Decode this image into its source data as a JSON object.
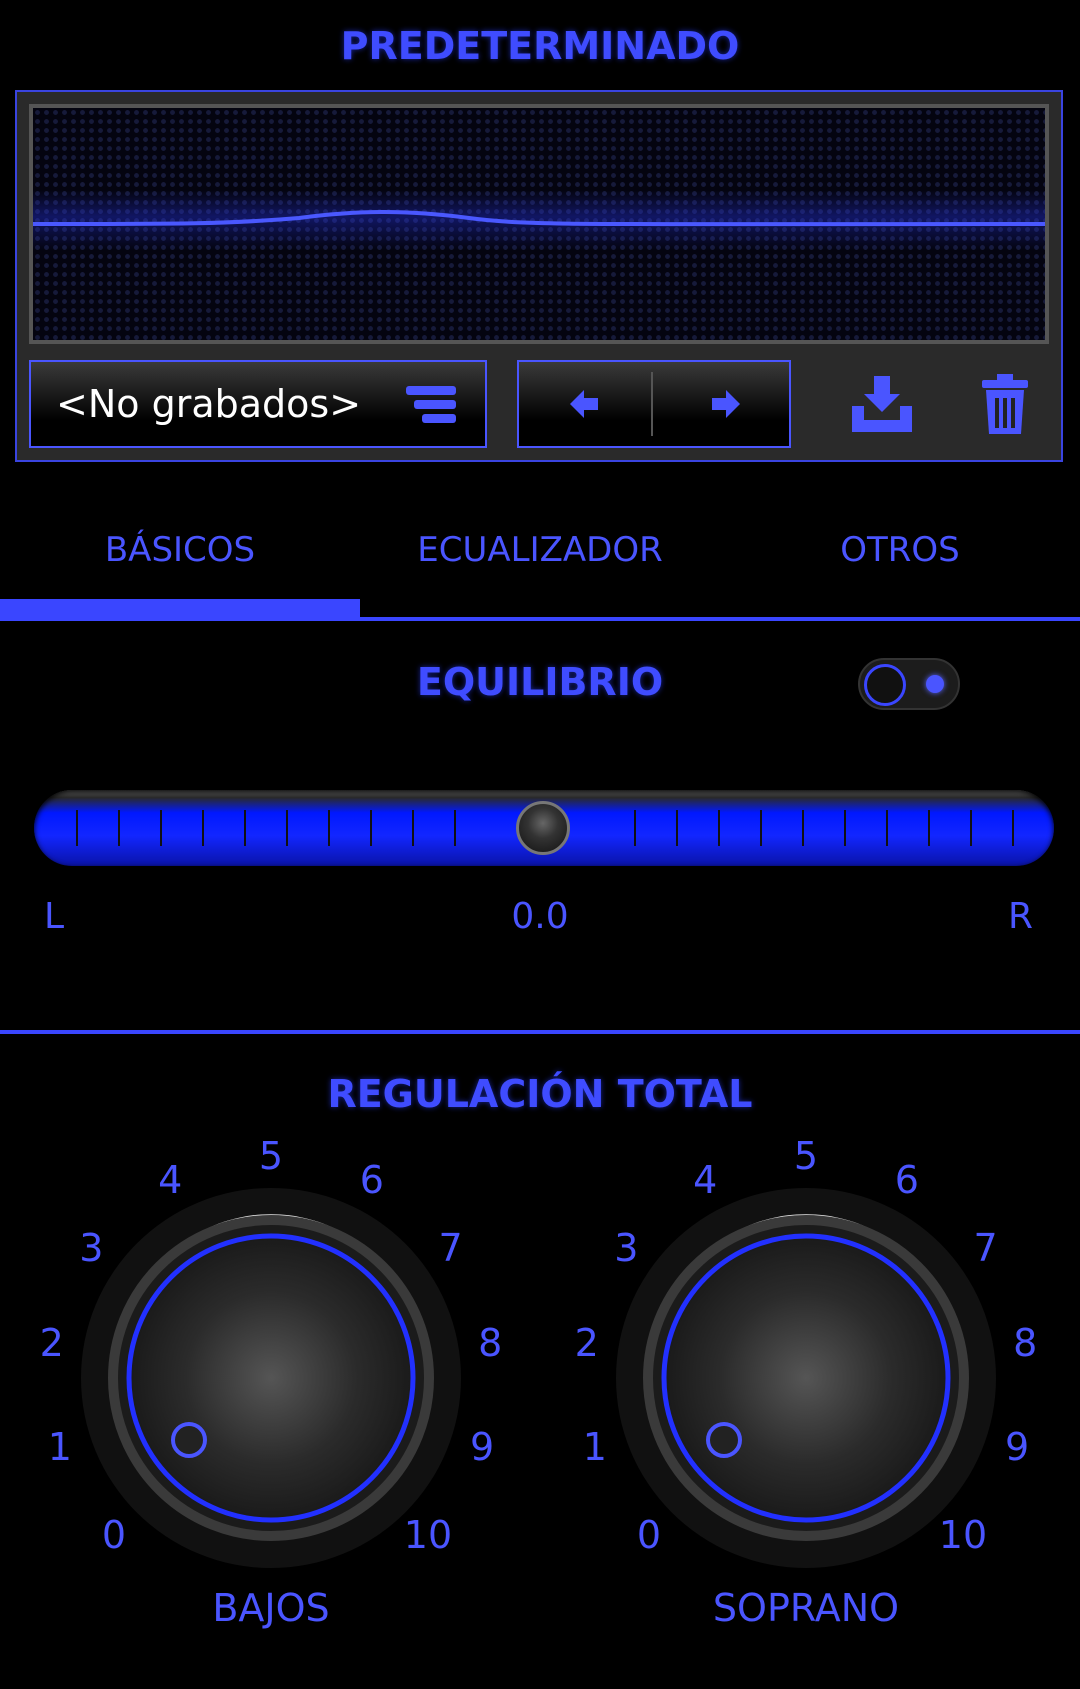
{
  "preset": {
    "title": "PREDETERMINADO",
    "name": "<No grabados>"
  },
  "icons": {
    "list": "list-lines-icon",
    "prev": "arrow-left-icon",
    "next": "arrow-right-icon",
    "save": "download-tray-icon",
    "delete": "trash-icon"
  },
  "tabs": [
    {
      "label": "BÁSICOS",
      "active": true
    },
    {
      "label": "ECUALIZADOR",
      "active": false
    },
    {
      "label": "OTROS",
      "active": false
    }
  ],
  "balance": {
    "title": "EQUILIBRIO",
    "left": "L",
    "value": "0.0",
    "right": "R",
    "enabled": true
  },
  "total": {
    "title": "REGULACIÓN TOTAL"
  },
  "knobs": [
    {
      "name": "BAJOS",
      "scale": [
        "0",
        "1",
        "2",
        "3",
        "4",
        "5",
        "6",
        "7",
        "8",
        "9",
        "10"
      ],
      "value": 0
    },
    {
      "name": "SOPRANO",
      "scale": [
        "0",
        "1",
        "2",
        "3",
        "4",
        "5",
        "6",
        "7",
        "8",
        "9",
        "10"
      ],
      "value": 0
    }
  ],
  "colors": {
    "accent": "#3f4cff",
    "background": "#000000"
  }
}
